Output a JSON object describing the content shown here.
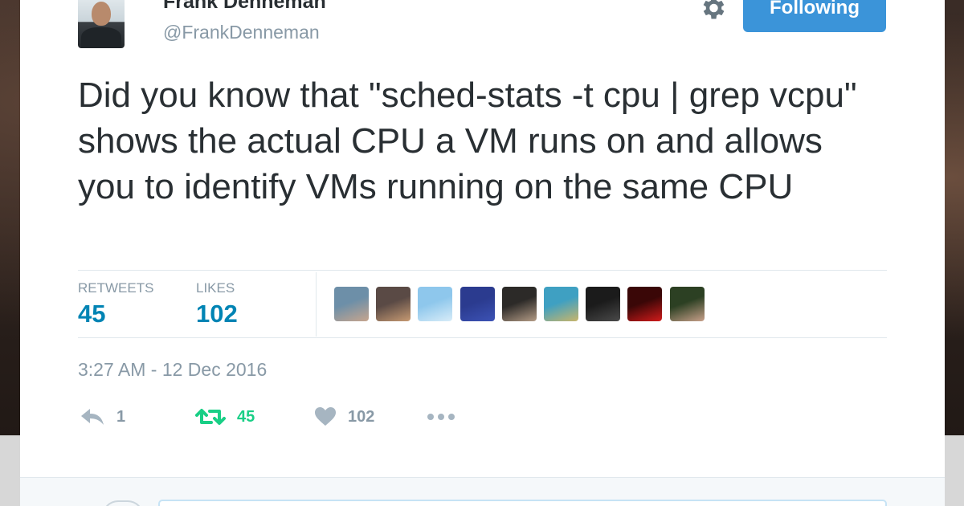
{
  "author": {
    "name": "Frank Denneman",
    "handle": "@FrankDenneman"
  },
  "header": {
    "follow_label": "Following",
    "settings_icon": "gear-icon"
  },
  "tweet": {
    "text": "Did you know that \"sched-stats -t cpu | grep vcpu\" shows the actual CPU a VM runs on and allows you to identify VMs running on the same CPU"
  },
  "stats": {
    "retweets_label": "RETWEETS",
    "retweets_value": "45",
    "likes_label": "LIKES",
    "likes_value": "102"
  },
  "likers": [
    {
      "name": "liker-avatar-1",
      "colors": [
        "#6d8fa8",
        "#c7a58e"
      ]
    },
    {
      "name": "liker-avatar-2",
      "colors": [
        "#5a4a45",
        "#c79a72"
      ]
    },
    {
      "name": "liker-avatar-3",
      "colors": [
        "#8ec7ec",
        "#d8ecf8"
      ]
    },
    {
      "name": "liker-avatar-4",
      "colors": [
        "#2b3b8f",
        "#3c52b5"
      ]
    },
    {
      "name": "liker-avatar-5",
      "colors": [
        "#2c2a28",
        "#b49c86"
      ]
    },
    {
      "name": "liker-avatar-6",
      "colors": [
        "#3fa0c2",
        "#c9b56a"
      ]
    },
    {
      "name": "liker-avatar-7",
      "colors": [
        "#1b1b1b",
        "#4a4a4a"
      ]
    },
    {
      "name": "liker-avatar-8",
      "colors": [
        "#3a0707",
        "#d11b1b"
      ]
    },
    {
      "name": "liker-avatar-9",
      "colors": [
        "#2c4023",
        "#c8a08a"
      ]
    }
  ],
  "timestamp": "3:27 AM - 12 Dec 2016",
  "actions": {
    "reply_count": "1",
    "retweet_count": "45",
    "like_count": "102",
    "reply_icon": "reply-icon",
    "retweet_icon": "retweet-icon",
    "like_icon": "heart-icon",
    "more_icon": "more-dots-icon"
  },
  "colors": {
    "accent": "#3b94d9",
    "link": "#0084b4",
    "retweet_active": "#19cf86",
    "muted": "#8899a6",
    "text": "#292f33"
  }
}
